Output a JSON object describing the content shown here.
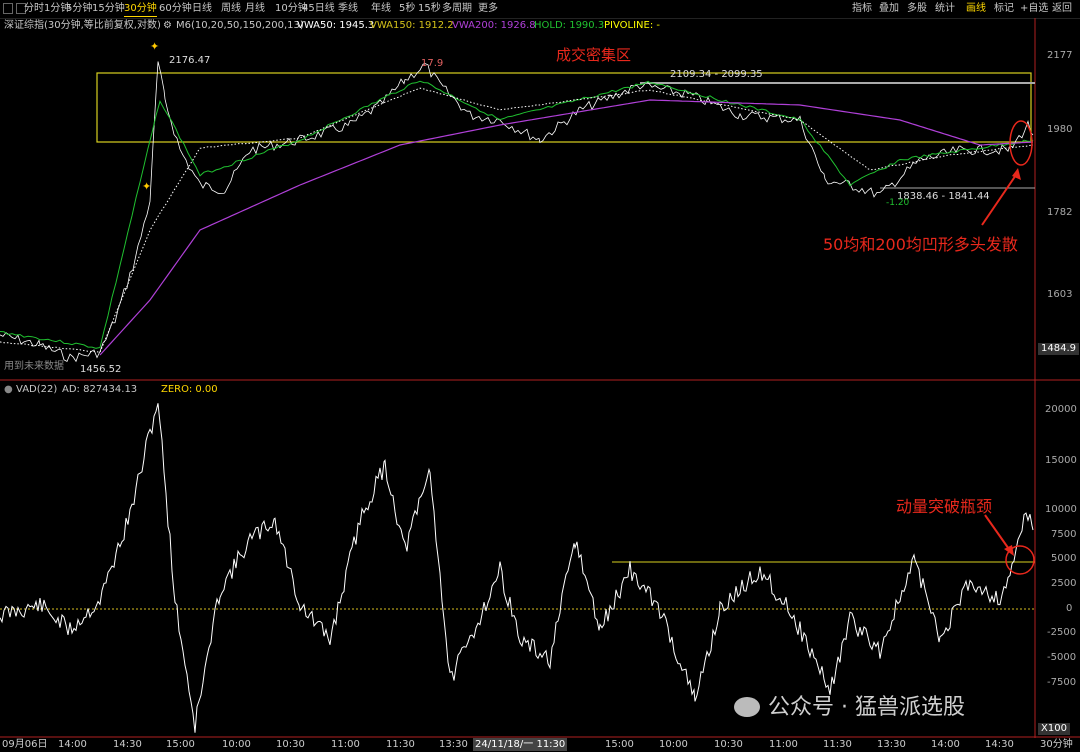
{
  "toolbar": {
    "periods": [
      "分时",
      "1分钟",
      "5分钟",
      "15分钟",
      "30分钟",
      "60分钟",
      "日线",
      "周线",
      "月线",
      "10分钟",
      "45日线",
      "季线",
      "年线",
      "5秒",
      "15秒",
      "多周期",
      "更多"
    ],
    "active_period": "30分钟",
    "right": [
      "指标",
      "叠加",
      "多股",
      "统计",
      "画线",
      "标记",
      "+自选",
      "返回"
    ],
    "active_right": "画线"
  },
  "legend": {
    "title": "深证综指(30分钟,等比前复权,对数)",
    "ma": "M6(10,20,50,150,200,13)",
    "vwa50": "VWA50: 1945.3",
    "vwa150": "VWA150: 1912.2",
    "vwa200": "VWA200: 1926.8",
    "hold": "HOLD: 1990.3",
    "pivoline": "PIVOLINE: -"
  },
  "colors": {
    "vwa50": "#ffffff",
    "vwa150": "#d4c21a",
    "vwa200": "#b040d8",
    "hold": "#20c030",
    "pivoline": "#ffff00",
    "annotation": "#e8281c",
    "box": "#d8d020"
  },
  "main_chart": {
    "y_ticks": [
      "2177",
      "1980",
      "1782",
      "1603"
    ],
    "current_price": "1484.9",
    "peak_label": "2176.47",
    "low_label": "1456.52",
    "peak2_label": "17.9",
    "range_label_top": "2109.34 - 2099.35",
    "range_label_bottom": "1838.46 - 1841.44",
    "small_label": "-1.20",
    "future_label": "用到未来数据",
    "box_title": "成交密集区",
    "annotation_ma": "50均和200均凹形多头发散"
  },
  "sub_chart": {
    "legend_name": "VAD(22)",
    "legend_ad": "AD: 827434.13",
    "legend_zero": "ZERO: 0.00",
    "y_ticks": [
      "20000",
      "15000",
      "10000",
      "7500",
      "5000",
      "2500",
      "0",
      "-2500",
      "-5000",
      "-7500"
    ],
    "scale": "X100",
    "annotation": "动量突破瓶颈"
  },
  "time_axis": {
    "labels": [
      "09月06日",
      "14:00",
      "14:30",
      "15:00",
      "10:00",
      "10:30",
      "11:00",
      "11:30",
      "13:30",
      "24/11/18/一 11:30",
      "15:00",
      "10:00",
      "10:30",
      "11:00",
      "11:30",
      "13:30",
      "14:00",
      "14:30"
    ],
    "period": "30分钟"
  },
  "watermark": "公众号 · 猛兽派选股"
}
